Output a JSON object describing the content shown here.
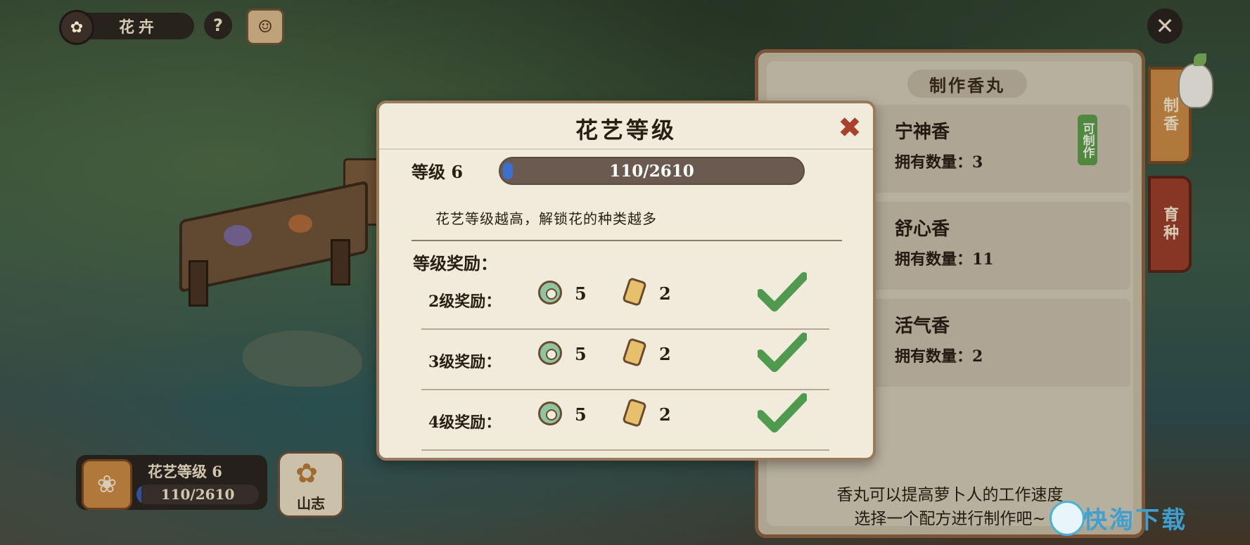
{
  "top_bar": {
    "title": "花卉",
    "help_label": "?"
  },
  "right_panel": {
    "title": "制作香丸",
    "recipes": [
      {
        "name": "宁神香",
        "count_label": "拥有数量：",
        "count": "3",
        "badge": "可制作"
      },
      {
        "name": "舒心香",
        "count_label": "拥有数量：",
        "count": "11"
      },
      {
        "name": "活气香",
        "count_label": "拥有数量：",
        "count": "2"
      }
    ],
    "footer_line1": "香丸可以提高萝卜人的工作速度",
    "footer_line2": "选择一个配方进行制作吧~",
    "tabs": {
      "make": "制香",
      "breed": "育种"
    }
  },
  "bottom_left": {
    "level_label": "花艺等级  6",
    "progress_text": "110/2610",
    "shanzhi_label": "山志"
  },
  "modal": {
    "title": "花艺等级",
    "level_label": "等级 6",
    "progress_text": "110/2610",
    "progress_fraction": 0.042,
    "description": "花艺等级越高，解锁花的种类越多",
    "rewards_header": "等级奖励：",
    "rewards": [
      {
        "label": "2级奖励：",
        "coin_qty": "5",
        "scroll_qty": "2",
        "claimed": true
      },
      {
        "label": "3级奖励：",
        "coin_qty": "5",
        "scroll_qty": "2",
        "claimed": true
      },
      {
        "label": "4级奖励：",
        "coin_qty": "5",
        "scroll_qty": "2",
        "claimed": true
      }
    ]
  },
  "watermark": "快淘下载",
  "colors": {
    "accent_orange": "#c98a44",
    "claim_green": "#4f9a4f",
    "progress_blue": "#3d6fd0"
  }
}
